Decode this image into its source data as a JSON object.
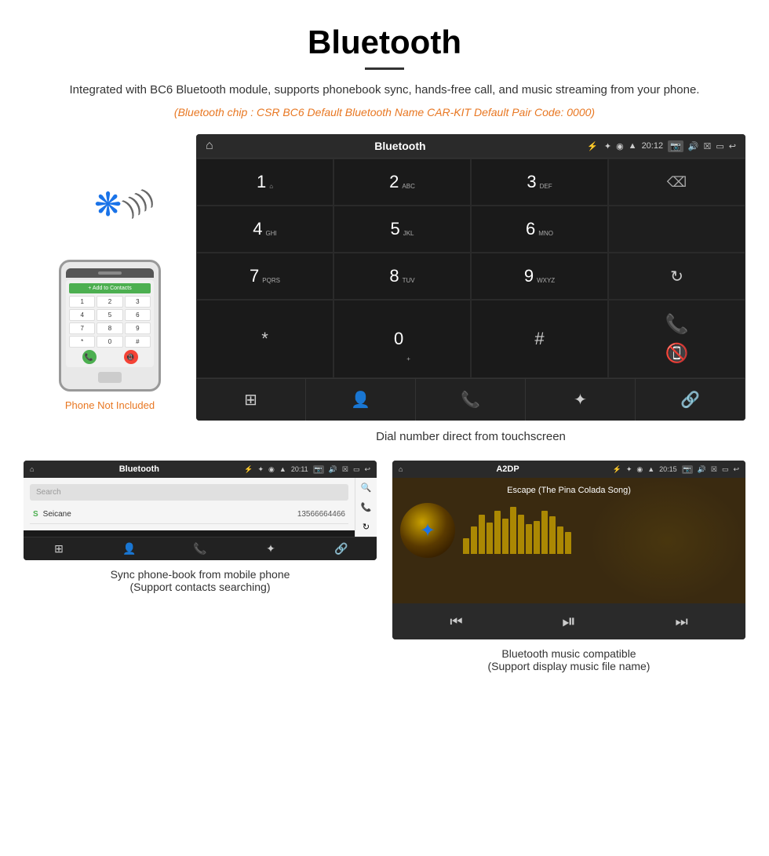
{
  "header": {
    "title": "Bluetooth",
    "description": "Integrated with BC6 Bluetooth module, supports phonebook sync, hands-free call, and music streaming from your phone.",
    "specs": "(Bluetooth chip : CSR BC6    Default Bluetooth Name CAR-KIT    Default Pair Code: 0000)"
  },
  "phone_label": "Phone Not Included",
  "head_unit": {
    "status_bar": {
      "title": "Bluetooth",
      "time": "20:12"
    },
    "dialpad": [
      {
        "num": "1",
        "sub": "⌂"
      },
      {
        "num": "2",
        "sub": "ABC"
      },
      {
        "num": "3",
        "sub": "DEF"
      },
      {
        "num": "",
        "sub": ""
      },
      {
        "num": "4",
        "sub": "GHI"
      },
      {
        "num": "5",
        "sub": "JKL"
      },
      {
        "num": "6",
        "sub": "MNO"
      },
      {
        "num": "",
        "sub": ""
      },
      {
        "num": "7",
        "sub": "PQRS"
      },
      {
        "num": "8",
        "sub": "TUV"
      },
      {
        "num": "9",
        "sub": "WXYZ"
      },
      {
        "num": "",
        "sub": "refresh"
      },
      {
        "num": "*",
        "sub": ""
      },
      {
        "num": "0",
        "sub": "+"
      },
      {
        "num": "#",
        "sub": ""
      },
      {
        "num": "",
        "sub": "call_controls"
      }
    ],
    "caption": "Dial number direct from touchscreen"
  },
  "phonebook_screen": {
    "status": {
      "title": "Bluetooth",
      "time": "20:11"
    },
    "search_placeholder": "Search",
    "contacts": [
      {
        "letter": "S",
        "name": "Seicane",
        "number": "13566664466"
      }
    ],
    "caption_line1": "Sync phone-book from mobile phone",
    "caption_line2": "(Support contacts searching)"
  },
  "music_screen": {
    "status": {
      "title": "A2DP",
      "time": "20:15"
    },
    "song": "Escape (The Pina Colada Song)",
    "viz_bars": [
      20,
      35,
      50,
      40,
      55,
      45,
      60,
      50,
      38,
      42,
      55,
      48,
      35,
      28
    ],
    "caption_line1": "Bluetooth music compatible",
    "caption_line2": "(Support display music file name)"
  },
  "icons": {
    "home": "⌂",
    "bluetooth": "✦",
    "usb": "⚡",
    "gps": "◉",
    "signal": "▲",
    "camera": "📷",
    "volume": "🔊",
    "close_box": "☒",
    "window": "▭",
    "back": "↩",
    "backspace": "⌫",
    "refresh": "↻",
    "call_green": "📞",
    "call_red": "📵",
    "grid": "⊞",
    "contacts": "👤",
    "phone": "📞",
    "bt": "✦",
    "link": "🔗",
    "search": "🔍",
    "prev": "⏮",
    "playpause": "⏯",
    "next": "⏭"
  }
}
